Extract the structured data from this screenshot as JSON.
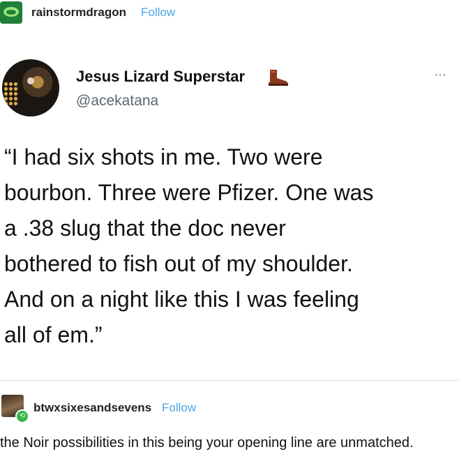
{
  "post": {
    "username": "rainstormdragon",
    "follow_label": "Follow",
    "avatar_icon": "dragon-icon"
  },
  "tweet": {
    "display_name": "Jesus Lizard Superstar",
    "name_emoji_icon": "boot-icon",
    "handle": "@acekatana",
    "more_icon": "more-horizontal-icon",
    "more_label": "···",
    "lines": [
      "“I had six shots in me. Two were",
      "bourbon. Three were Pfizer. One was",
      "a .38 slug that the doc never",
      "bothered to fish out of my shoulder.",
      "And on a night like this I was feeling",
      "all of em.”"
    ]
  },
  "reblog": {
    "username": "btwxsixesandsevens",
    "follow_label": "Follow",
    "reblog_icon": "reblog-icon",
    "comment": "the Noir possibilities in this being your opening line are unmatched."
  },
  "colors": {
    "follow_blue": "#4aa6e8",
    "handle_gray": "#5b6670",
    "reblog_green": "#38b54a"
  }
}
